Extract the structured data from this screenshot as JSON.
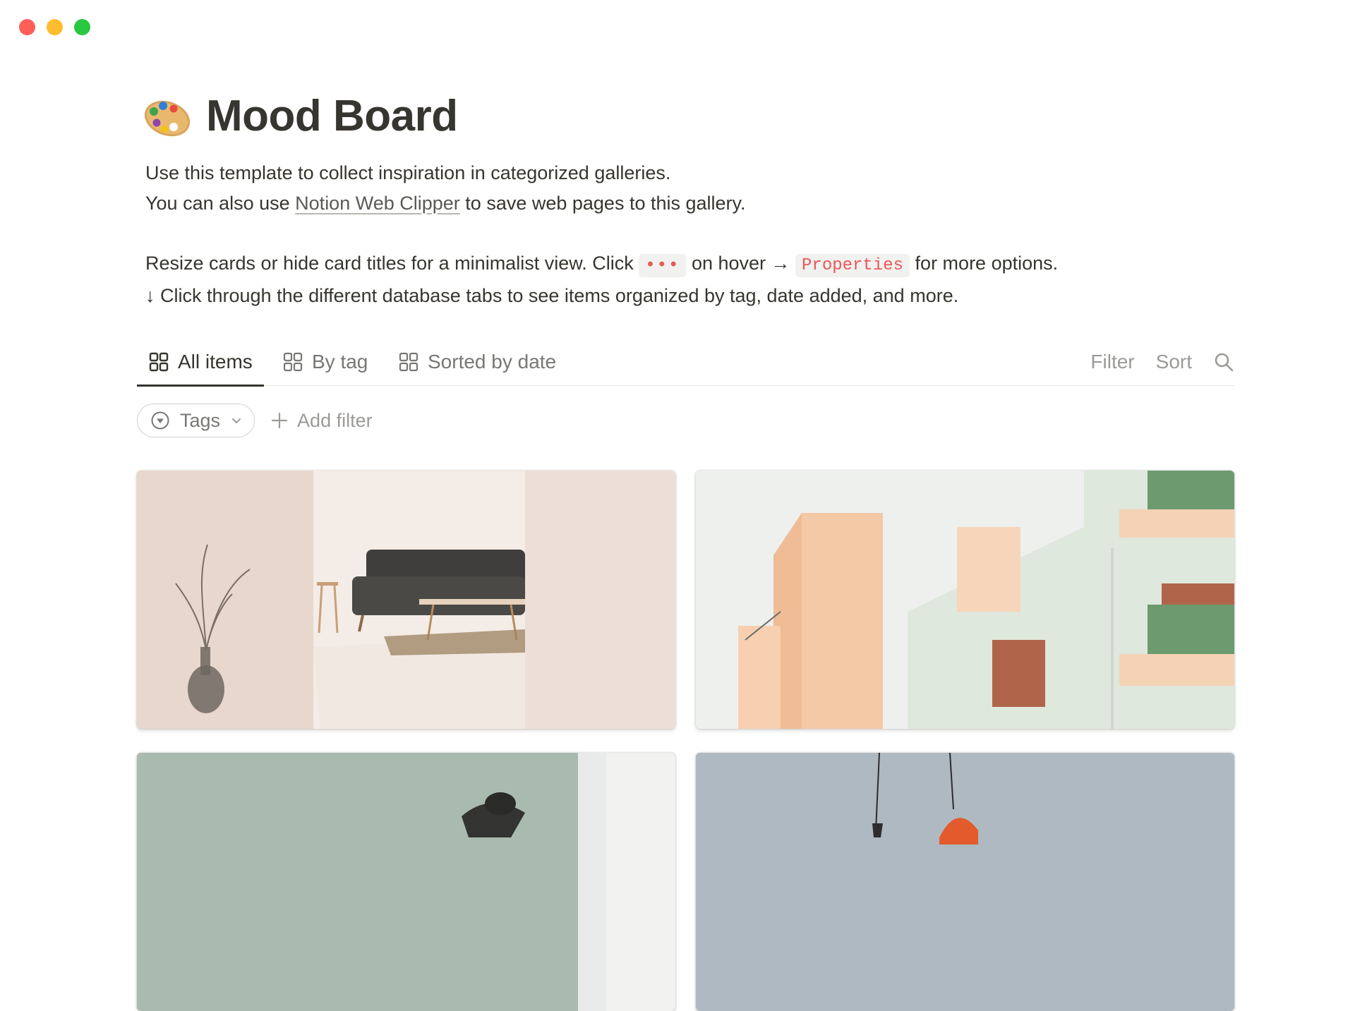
{
  "window": {
    "controls": [
      {
        "name": "close",
        "color": "#ff5f57"
      },
      {
        "name": "minimize",
        "color": "#febc2e"
      },
      {
        "name": "maximize",
        "color": "#28c840"
      }
    ]
  },
  "page": {
    "icon": "artist-palette-icon",
    "title": "Mood Board",
    "description": {
      "line1": "Use this template to collect inspiration in categorized galleries.",
      "line2_prefix": "You can also use ",
      "line2_link": "Notion Web Clipper",
      "line2_suffix": " to save web pages to this gallery.",
      "line3_prefix": "Resize cards or hide card titles for a minimalist view. Click ",
      "line3_code1": "•••",
      "line3_middle": " on hover → ",
      "line3_code2": "Properties",
      "line3_suffix": " for more options.",
      "line4": "↓ Click through the different database tabs to see items organized by tag, date added, and more."
    }
  },
  "database": {
    "tabs": [
      {
        "label": "All items",
        "icon": "gallery-grid-icon",
        "active": true
      },
      {
        "label": "By tag",
        "icon": "gallery-grid-icon",
        "active": false
      },
      {
        "label": "Sorted by date",
        "icon": "gallery-grid-icon",
        "active": false
      }
    ],
    "toolbar": {
      "filter_label": "Filter",
      "sort_label": "Sort",
      "search_icon": "search-icon"
    },
    "filters": {
      "tags_label": "Tags",
      "add_filter_label": "Add filter"
    },
    "cards": [
      {
        "image": "minimal-interior-sofa-vase"
      },
      {
        "image": "pastel-building-balconies"
      },
      {
        "image": "sage-wall-desk-lamp"
      },
      {
        "image": "orange-lamp-grey-sky"
      }
    ]
  },
  "colors": {
    "text": "#37352f",
    "muted": "#787774",
    "code_red": "#eb5757",
    "divider": "#e9e9e7"
  }
}
